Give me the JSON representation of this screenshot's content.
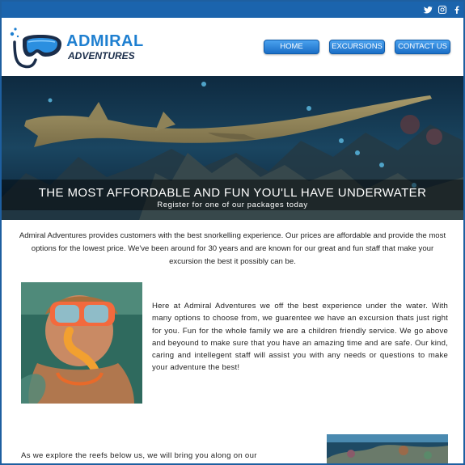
{
  "topbar": {
    "social": [
      {
        "name": "twitter-icon",
        "color": "#ffffff"
      },
      {
        "name": "instagram-icon",
        "color": "#ffffff"
      },
      {
        "name": "facebook-icon",
        "color": "#ffffff"
      }
    ],
    "bar_color": "#1b64ad"
  },
  "brand": {
    "line1": "ADMIRAL",
    "line2": "ADVENTURES",
    "logo_icon": "snorkel-mask-logo",
    "accent_color": "#1e7fd0"
  },
  "nav": {
    "home": "HOME",
    "excursions": "EXCURSIONS",
    "contact": "CONTACT US"
  },
  "hero": {
    "title": "THE MOST AFFORDABLE AND FUN YOU'LL HAVE UNDERWATER",
    "subtitle": "Register for one of our packages today"
  },
  "intro": {
    "text": "Admiral Adventures provides customers with the best snorkelling experience. Our prices are affordable and provide the most options for the lowest price. We've been around for 30 years and are known for our great and fun staff that make your excursion the best it possibly can be."
  },
  "section2": {
    "text": "Here at Admiral Adventures we off the best experience under the water. With many options to choose from, we guarentee we have an excursion thats just right for you. Fun for the whole family we are a children friendly service. We go above and beyound to make sure that you have an amazing time and are safe. Our kind, caring and intellegent staff will assist you with any needs or questions to make your adventure the best!"
  },
  "section3": {
    "text": "As we explore the reefs below us, we will bring you along on our"
  }
}
